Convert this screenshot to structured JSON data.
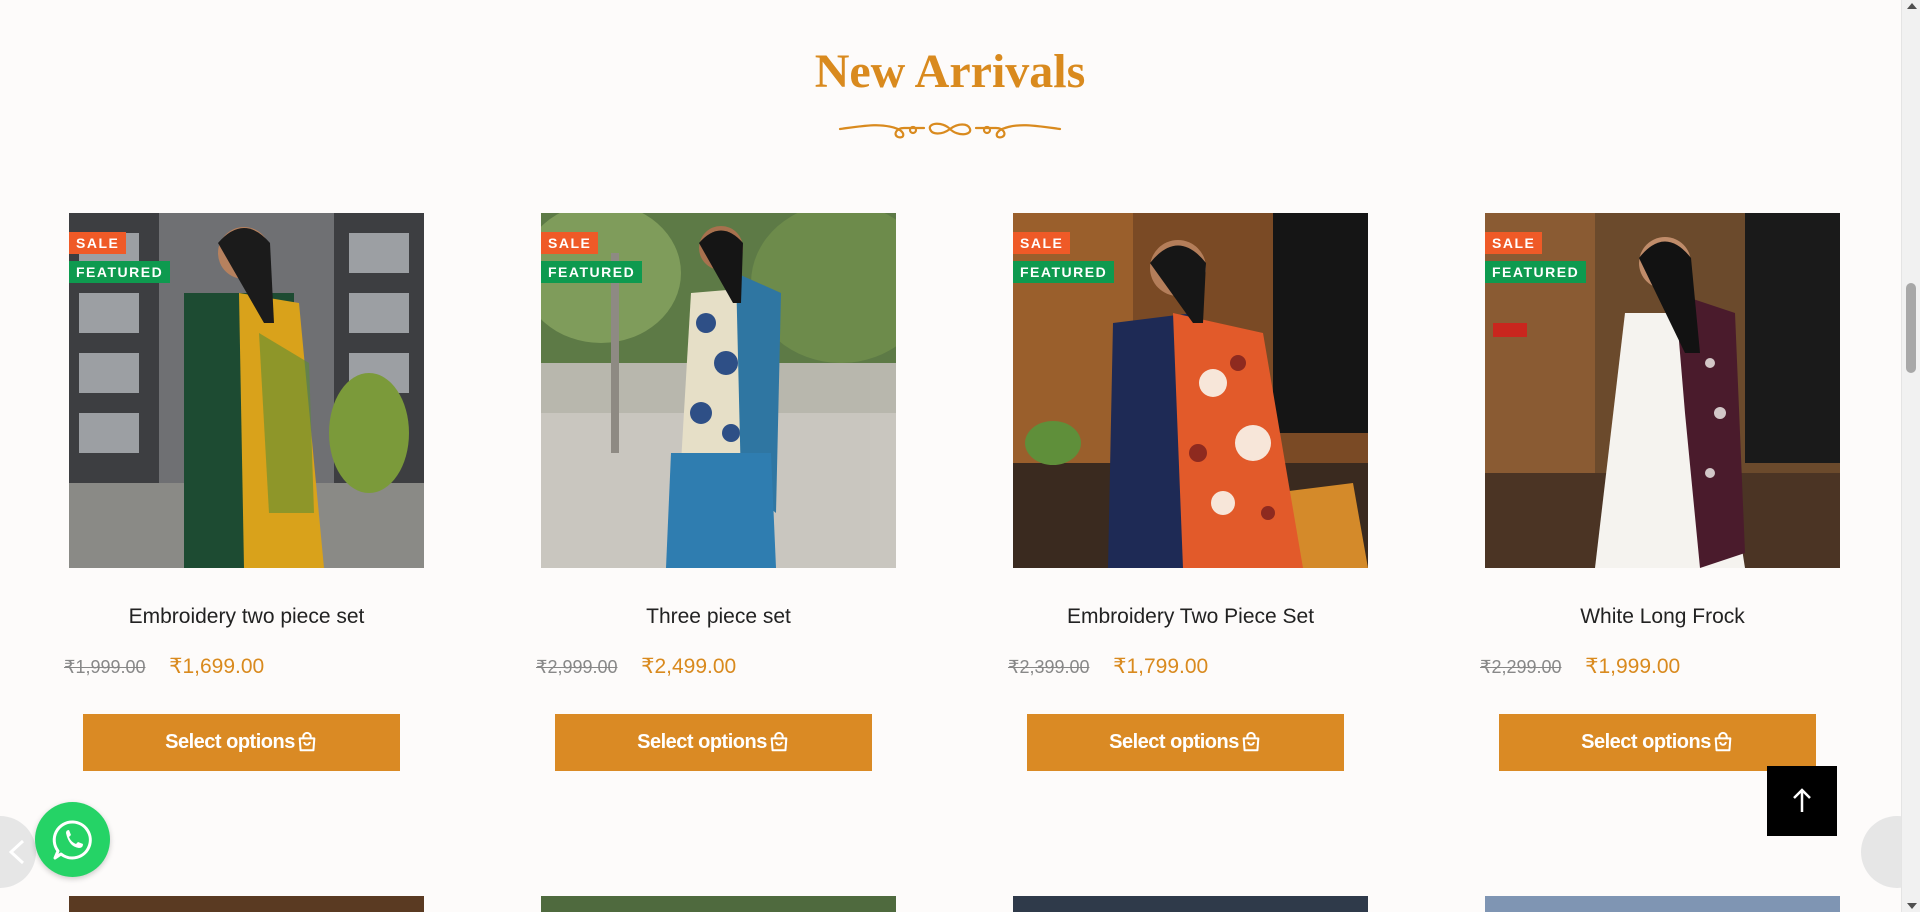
{
  "section": {
    "title": "New Arrivals"
  },
  "colors": {
    "accent": "#da8a24",
    "sale_badge": "#ef5a27",
    "featured_badge": "#0e9a4f",
    "whatsapp": "#25d366"
  },
  "badges": {
    "sale": "SALE",
    "featured": "FEATURED"
  },
  "products": [
    {
      "name": "Embroidery two piece set",
      "old_price": "₹1,999.00",
      "new_price": "₹1,699.00",
      "button": "Select options"
    },
    {
      "name": "Three piece set",
      "old_price": "₹2,999.00",
      "new_price": "₹2,499.00",
      "button": "Select options"
    },
    {
      "name": "Embroidery Two Piece Set",
      "old_price": "₹2,399.00",
      "new_price": "₹1,799.00",
      "button": "Select options"
    },
    {
      "name": "White Long Frock",
      "old_price": "₹2,299.00",
      "new_price": "₹1,999.00",
      "button": "Select options"
    }
  ],
  "icons": {
    "whatsapp": "whatsapp-icon",
    "back_to_top": "arrow-up-icon",
    "prev": "chevron-left-icon",
    "next": "chevron-right-icon",
    "bag": "shopping-bag-icon"
  }
}
